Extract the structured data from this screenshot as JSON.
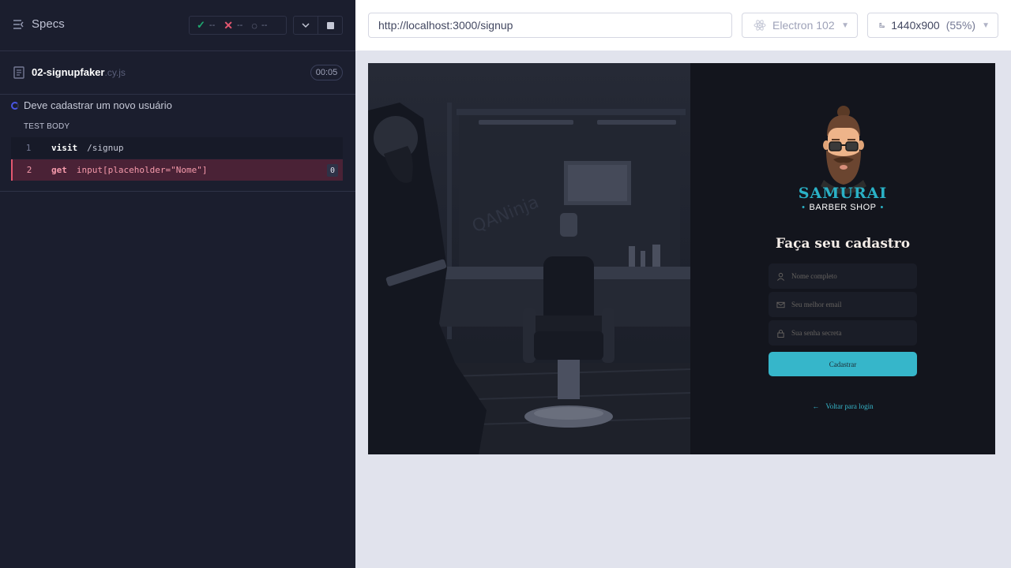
{
  "reporter": {
    "specs_label": "Specs",
    "stats": {
      "passed": "--",
      "failed": "--",
      "pending": "--"
    },
    "spec": {
      "name": "02-signupfaker",
      "ext": ".cy.js",
      "timer": "00:05"
    },
    "test": {
      "title": "Deve cadastrar um novo usuário",
      "body_label": "TEST BODY"
    },
    "commands": [
      {
        "number": "1",
        "name": "visit",
        "message": "/signup"
      },
      {
        "number": "2",
        "name": "get",
        "message": "input[placeholder=\"Nome\"]",
        "badge": "0"
      }
    ]
  },
  "topbar": {
    "url": "http://localhost:3000/signup",
    "browser": "Electron 102",
    "viewport": "1440x900",
    "scale": "(55%)"
  },
  "app": {
    "brand_main": "SAMURAI",
    "brand_sub": "BARBER SHOP",
    "brand_dot": "•",
    "form_title": "Faça seu cadastro",
    "name_placeholder": "Nome completo",
    "email_placeholder": "Seu melhor email",
    "password_placeholder": "Sua senha secreta",
    "submit_label": "Cadastrar",
    "back_label": "Voltar para login",
    "watermark": "QANinja"
  },
  "colors": {
    "reporter_bg": "#1b1e2e",
    "accent_teal": "#36b6ca",
    "fail_red": "#e45770",
    "pass_green": "#1fa971"
  }
}
